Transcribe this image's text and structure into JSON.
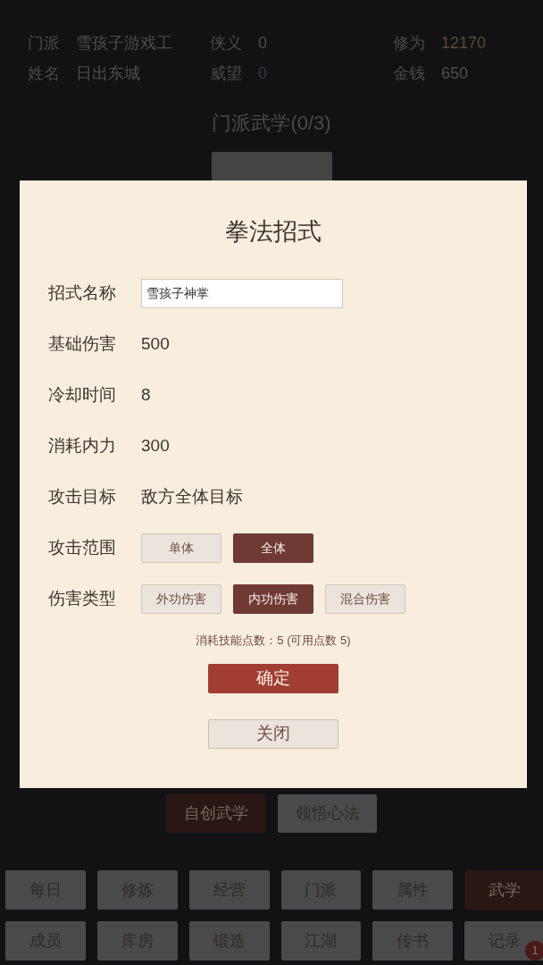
{
  "stats": [
    {
      "label": "门派",
      "value": "雪孩子游戏工",
      "color": "#4f4f4f"
    },
    {
      "label": "侠义",
      "value": "0",
      "color": "#4f4f4f"
    },
    {
      "label": "修为",
      "value": "12170",
      "color": "#5a4c35"
    },
    {
      "label": "姓名",
      "value": "日出东城",
      "color": "#4f4f4f"
    },
    {
      "label": "威望",
      "value": "0",
      "color": "#2c3c4c"
    },
    {
      "label": "金钱",
      "value": "650",
      "color": "#4f4f4f"
    }
  ],
  "section_title": "门派武学(0/3)",
  "dialog": {
    "title": "拳法招式",
    "fields": [
      {
        "kind": "input",
        "label": "招式名称",
        "value": "雪孩子神掌"
      },
      {
        "kind": "text",
        "label": "基础伤害",
        "value": "500"
      },
      {
        "kind": "text",
        "label": "冷却时间",
        "value": "8"
      },
      {
        "kind": "text",
        "label": "消耗内力",
        "value": "300"
      },
      {
        "kind": "text",
        "label": "攻击目标",
        "value": "敌方全体目标"
      },
      {
        "kind": "options",
        "label": "攻击范围",
        "options": [
          {
            "label": "单体",
            "selected": false
          },
          {
            "label": "全体",
            "selected": true
          }
        ]
      },
      {
        "kind": "options",
        "label": "伤害类型",
        "options": [
          {
            "label": "外功伤害",
            "selected": false
          },
          {
            "label": "内功伤害",
            "selected": true
          },
          {
            "label": "混合伤害",
            "selected": false
          }
        ]
      }
    ],
    "points_note": "消耗技能点数：5 (可用点数 5)",
    "confirm": "确定",
    "close": "关闭"
  },
  "sub_tabs": [
    {
      "label": "自创武学",
      "selected": true
    },
    {
      "label": "领悟心法",
      "selected": false
    }
  ],
  "nav": [
    {
      "label": "每日",
      "selected": false
    },
    {
      "label": "修炼",
      "selected": false
    },
    {
      "label": "经营",
      "selected": false
    },
    {
      "label": "门派",
      "selected": false
    },
    {
      "label": "属性",
      "selected": false
    },
    {
      "label": "武学",
      "selected": true
    },
    {
      "label": "成员",
      "selected": false
    },
    {
      "label": "库房",
      "selected": false
    },
    {
      "label": "锻造",
      "selected": false
    },
    {
      "label": "江湖",
      "selected": false
    },
    {
      "label": "传书",
      "selected": false
    },
    {
      "label": "记录",
      "selected": false,
      "badge": "1"
    }
  ]
}
